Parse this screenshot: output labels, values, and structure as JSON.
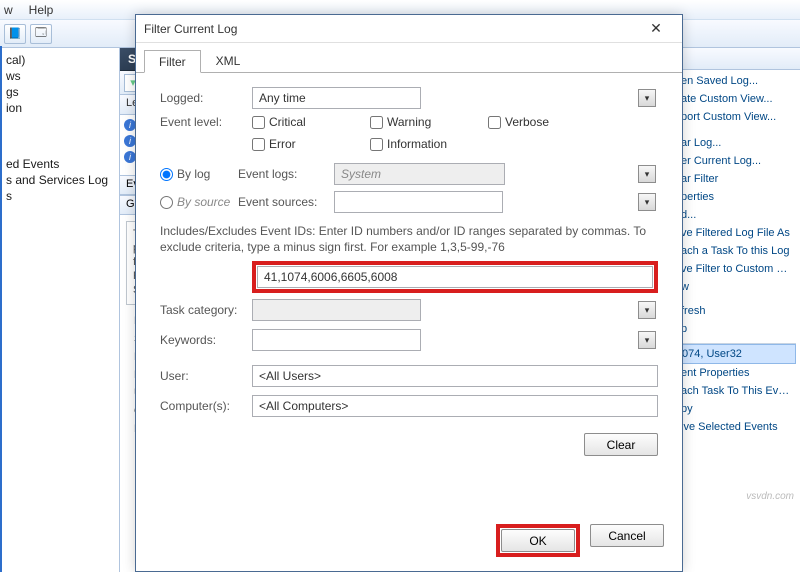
{
  "menubar": {
    "view": "w",
    "help": "Help"
  },
  "tree": {
    "items": [
      "cal)",
      "ws",
      "gs",
      "ion"
    ],
    "groups": [
      "ed Events",
      "s and Services Log",
      "s"
    ]
  },
  "mid": {
    "header": "Syste",
    "level_col": "Lev",
    "info_row": "In",
    "events_header": "Event",
    "general_header": "Ger",
    "innerbox": [
      "T",
      "p",
      "fo",
      "P",
      "S"
    ],
    "detail_labels": [
      "Lo",
      "So",
      "Ev",
      "Le",
      "U",
      "O",
      "M"
    ]
  },
  "right": {
    "items": [
      "en Saved Log...",
      "ate Custom View...",
      "port Custom View...",
      "ar Log...",
      "er Current Log...",
      "ar Filter",
      "perties",
      "d...",
      "ve Filtered Log File As",
      "ach a Task To this Log",
      "ve Filter to Custom Vie",
      "w",
      "fresh",
      "p"
    ],
    "selected": "074, User32",
    "tail": [
      "ent Properties",
      "ach Task To This Even",
      "py",
      "ive Selected Events"
    ]
  },
  "dialog": {
    "title": "Filter Current Log",
    "tabs": {
      "filter": "Filter",
      "xml": "XML"
    },
    "logged_label": "Logged:",
    "logged_value": "Any time",
    "eventlevel_label": "Event level:",
    "checks": {
      "critical": "Critical",
      "warning": "Warning",
      "verbose": "Verbose",
      "error": "Error",
      "information": "Information"
    },
    "bylog": "By log",
    "bysource": "By source",
    "eventlogs_label": "Event logs:",
    "eventlogs_value": "System",
    "eventsources_label": "Event sources:",
    "desc": "Includes/Excludes Event IDs: Enter ID numbers and/or ID ranges separated by commas. To exclude criteria, type a minus sign first. For example 1,3,5-99,-76",
    "eventids_value": "41,1074,6006,6605,6008",
    "taskcat_label": "Task category:",
    "keywords_label": "Keywords:",
    "user_label": "User:",
    "user_value": "<All Users>",
    "computers_label": "Computer(s):",
    "computers_value": "<All Computers>",
    "clear_btn": "Clear",
    "ok_btn": "OK",
    "cancel_btn": "Cancel"
  },
  "watermark": "vsvdn.com"
}
